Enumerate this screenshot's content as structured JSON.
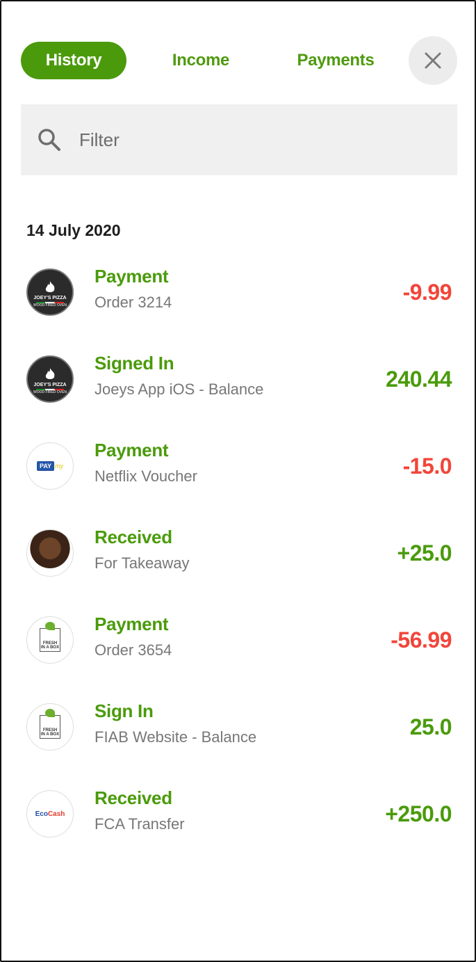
{
  "tabs": {
    "history": "History",
    "income": "Income",
    "payments": "Payments"
  },
  "search": {
    "placeholder": "Filter"
  },
  "section": {
    "date": "14 July 2020"
  },
  "transactions": [
    {
      "title": "Payment",
      "subtitle": "Order 3214",
      "amount": "-9.99",
      "sign": "negative",
      "icon": "joeys-pizza-logo"
    },
    {
      "title": "Signed In",
      "subtitle": "Joeys App iOS - Balance",
      "amount": "240.44",
      "sign": "positive",
      "icon": "joeys-pizza-logo"
    },
    {
      "title": "Payment",
      "subtitle": "Netflix Voucher",
      "amount": "-15.0",
      "sign": "negative",
      "icon": "paymy-logo"
    },
    {
      "title": "Received",
      "subtitle": "For Takeaway",
      "amount": "+25.0",
      "sign": "positive",
      "icon": "user-avatar"
    },
    {
      "title": "Payment",
      "subtitle": "Order 3654",
      "amount": "-56.99",
      "sign": "negative",
      "icon": "fresh-in-a-box-logo"
    },
    {
      "title": "Sign In",
      "subtitle": "FIAB Website - Balance",
      "amount": "25.0",
      "sign": "positive",
      "icon": "fresh-in-a-box-logo"
    },
    {
      "title": "Received",
      "subtitle": "FCA Transfer",
      "amount": "+250.0",
      "sign": "positive",
      "icon": "ecocash-logo"
    }
  ],
  "logos": {
    "pizza_top": "JOEY'S PIZZA",
    "pizza_bottom": "WOOD FIRED OVEN",
    "paymy_a": "PAY",
    "paymy_b": "my",
    "fiab_a": "FRESH",
    "fiab_b": "IN A BOX",
    "eco_a": "Eco",
    "eco_b": "Cash"
  },
  "colors": {
    "accent": "#4b9a0c",
    "negative": "#f2453a",
    "positive": "#4a9b0b"
  }
}
